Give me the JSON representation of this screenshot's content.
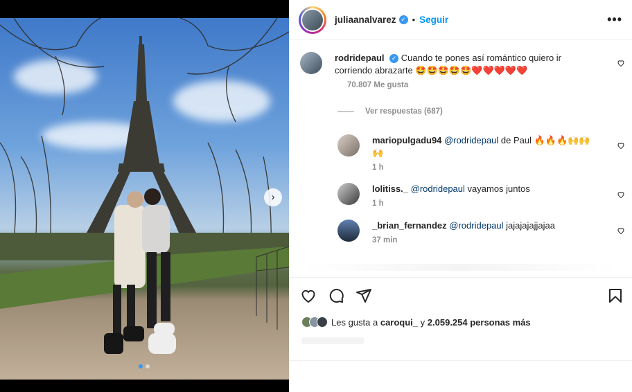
{
  "post": {
    "author": "juliaanalvarez",
    "follow_label": "Seguir",
    "separator": "•",
    "more_label": "•••"
  },
  "caption": {
    "author": "rodridepaul",
    "text": "Cuando te pones así romántico quiero ir corriendo abrazarte 🤩🤩🤩🤩🤩❤️❤️❤️❤️❤️",
    "likes": "70.807 Me gusta",
    "view_replies": "Ver respuestas (687)"
  },
  "comments": [
    {
      "author": "mariopulgadu94",
      "mention": "@rodridepaul",
      "text": "de Paul 🔥🔥🔥🙌🙌🙌",
      "time": "1 h"
    },
    {
      "author": "lolitiss._",
      "mention": "@rodridepaul",
      "text": "vayamos juntos",
      "time": "1 h"
    },
    {
      "author": "_brian_fernandez",
      "mention": "@rodridepaul",
      "text": "jajajajajjajaa",
      "time": "37 min"
    }
  ],
  "likes_summary": {
    "prefix": "Les gusta a",
    "user": "caroqui_",
    "middle": "y",
    "count": "2.059.254 personas más"
  },
  "carousel": {
    "next_arrow": "›",
    "page": 1,
    "pages": 2
  },
  "colors": {
    "accent": "#0095f6",
    "verified": "#3897f0",
    "mention": "#00376b"
  }
}
